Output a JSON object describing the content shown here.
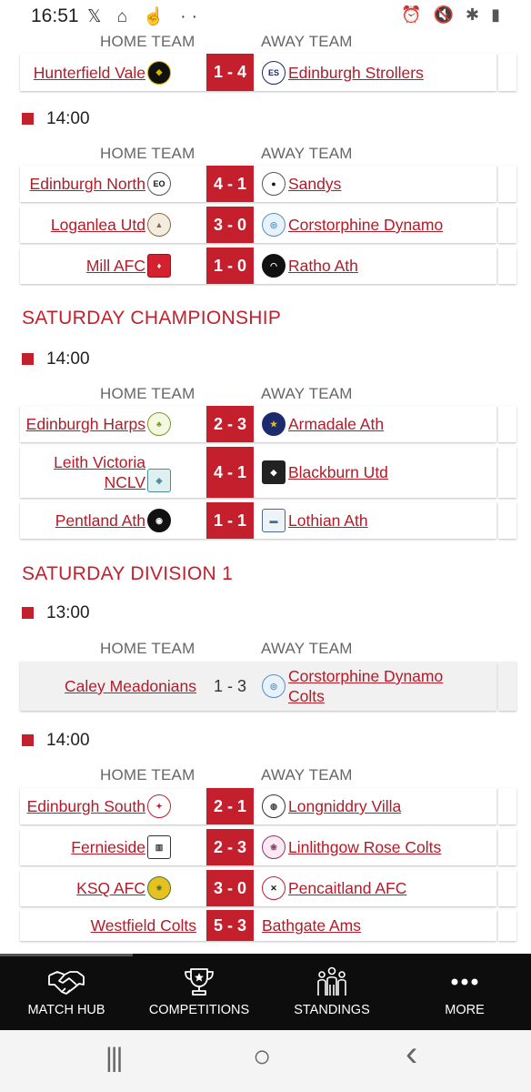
{
  "status_bar": {
    "time": "16:51",
    "left_icons": "𝕏 ⌂ ☝ ··",
    "right_icons": "⏰ 🔇 ✱ ▮"
  },
  "col_headers": {
    "home": "HOME TEAM",
    "away": "AWAY TEAM"
  },
  "sections": {
    "s0": {
      "rows": [
        {
          "home": "Hunterfield Vale",
          "score": "1 - 4",
          "away": "Edinburgh Strollers"
        }
      ]
    },
    "s1": {
      "time": "14:00",
      "rows": [
        {
          "home": "Edinburgh North",
          "score": "4 - 1",
          "away": "Sandys"
        },
        {
          "home": "Loganlea Utd",
          "score": "3 - 0",
          "away": "Corstorphine Dynamo"
        },
        {
          "home": "Mill AFC",
          "score": "1 - 0",
          "away": "Ratho Ath"
        }
      ]
    },
    "championship": {
      "title": "SATURDAY CHAMPIONSHIP",
      "time": "14:00",
      "rows": [
        {
          "home": "Edinburgh Harps",
          "score": "2 - 3",
          "away": "Armadale Ath"
        },
        {
          "home_line1": "Leith Victoria",
          "home_line2": "NCLV",
          "score": "4 - 1",
          "away": "Blackburn Utd"
        },
        {
          "home": "Pentland Ath",
          "score": "1 - 1",
          "away": "Lothian Ath"
        }
      ]
    },
    "division1": {
      "title": "SATURDAY DIVISION 1",
      "time_a": "13:00",
      "rows_a": [
        {
          "home": "Caley Meadonians",
          "score": "1 - 3",
          "away_line1": "Corstorphine Dynamo",
          "away_line2": "Colts"
        }
      ],
      "time_b": "14:00",
      "rows_b": [
        {
          "home": "Edinburgh South",
          "score": "2 - 1",
          "away": "Longniddry Villa"
        },
        {
          "home": "Fernieside",
          "score": "2 - 3",
          "away": "Linlithgow Rose Colts"
        },
        {
          "home": "KSQ AFC",
          "score": "3 - 0",
          "away": "Pencaitland AFC"
        },
        {
          "home": "Westfield Colts",
          "score": "5 - 3",
          "away": "Bathgate Ams"
        }
      ]
    }
  },
  "badges": {
    "es": "ES",
    "en": "EO"
  },
  "bottom_nav": [
    {
      "label": "MATCH HUB",
      "icon": "handshake-icon"
    },
    {
      "label": "COMPETITIONS",
      "icon": "trophy-icon"
    },
    {
      "label": "STANDINGS",
      "icon": "people-icon"
    },
    {
      "label": "MORE",
      "icon": "more-dots-icon"
    }
  ],
  "system_nav": {
    "recents": "|||",
    "home": "○",
    "back": "‹"
  },
  "colors": {
    "accent": "#c41f2c",
    "nav_bg": "#0d0d0d"
  }
}
